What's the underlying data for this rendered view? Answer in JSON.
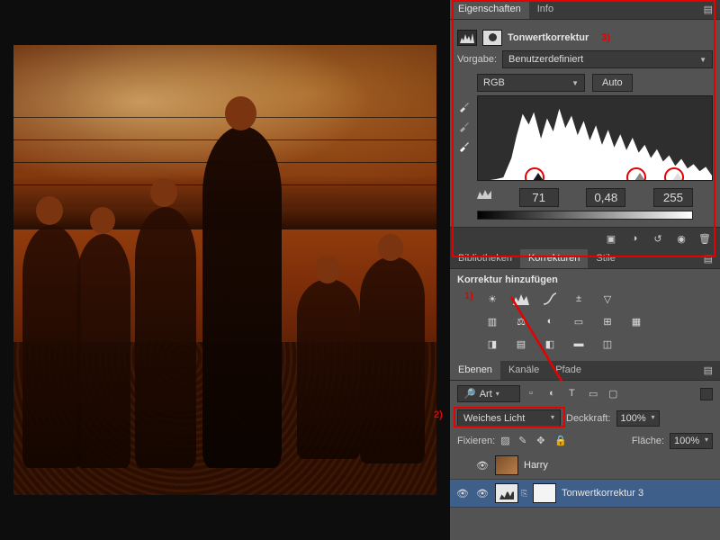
{
  "tabs": {
    "eigenschaften": "Eigenschaften",
    "info": "Info"
  },
  "props": {
    "title": "Tonwertkorrektur",
    "anno3": "3)",
    "preset_label": "Vorgabe:",
    "preset_value": "Benutzerdefiniert",
    "channel": "RGB",
    "auto": "Auto",
    "shadow": "71",
    "mid": "0,48",
    "highlight": "255"
  },
  "korr_tabs": {
    "bibliotheken": "Bibliotheken",
    "korrekturen": "Korrekturen",
    "stile": "Stile"
  },
  "korr": {
    "title": "Korrektur hinzufügen",
    "anno1": "1)"
  },
  "layers_tabs": {
    "ebenen": "Ebenen",
    "kanaele": "Kanäle",
    "pfade": "Pfade"
  },
  "layers": {
    "kind": "Art",
    "search_glyph": "🔎",
    "blend_mode": "Weiches Licht",
    "anno2": "2)",
    "opacity_label": "Deckkraft:",
    "opacity_value": "100%",
    "lock_label": "Fixieren:",
    "fill_label": "Fläche:",
    "fill_value": "100%",
    "rows": [
      {
        "name": "Harry"
      },
      {
        "name": "Tonwertkorrektur 3"
      }
    ]
  }
}
